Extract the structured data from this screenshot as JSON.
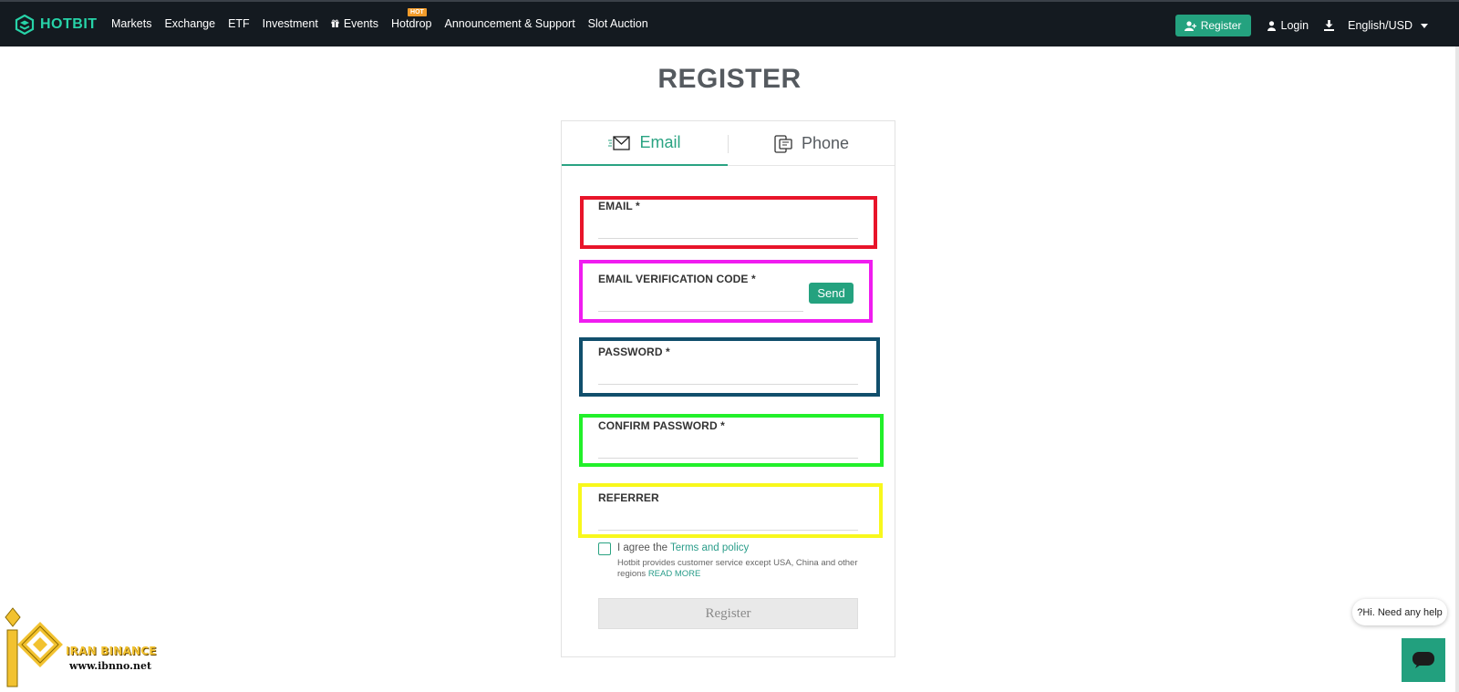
{
  "header": {
    "brand": "HOTBIT",
    "nav": [
      {
        "label": "Markets"
      },
      {
        "label": "Exchange"
      },
      {
        "label": "ETF"
      },
      {
        "label": "Investment"
      },
      {
        "label": "Events",
        "icon": "gift-icon"
      },
      {
        "label": "Hotdrop",
        "badge": "HOT"
      },
      {
        "label": "Announcement & Support"
      },
      {
        "label": "Slot Auction"
      }
    ],
    "register_label": "Register",
    "login_label": "Login",
    "language_label": "English/USD"
  },
  "page": {
    "title": "REGISTER"
  },
  "tabs": [
    {
      "label": "Email",
      "icon": "envelope-icon",
      "active": true
    },
    {
      "label": "Phone",
      "icon": "phone-icon",
      "active": false
    }
  ],
  "form": {
    "email_label": "EMAIL *",
    "email_value": "",
    "code_label": "EMAIL VERIFICATION CODE *",
    "code_value": "",
    "send_label": "Send",
    "password_label": "PASSWORD *",
    "password_value": "",
    "confirm_label": "CONFIRM PASSWORD *",
    "confirm_value": "",
    "referrer_label": "REFERRER",
    "referrer_value": "",
    "agree_prefix": "I agree the ",
    "terms_label": "Terms and policy",
    "note_text": "Hotbit provides customer service except USA, China and other regions ",
    "read_more_label": "READ MORE",
    "submit_label": "Register"
  },
  "highlight_colors": {
    "email": "#e8142a",
    "code": "#f01cf0",
    "password": "#114f6c",
    "confirm": "#22f02a",
    "referrer": "#f8f81c"
  },
  "chat": {
    "bubble_text": "?Hi. Need any help"
  },
  "watermark": {
    "line1": "IRAN BINANCE",
    "line2": "www.ibnno.net"
  },
  "colors": {
    "brand": "#27d3a8",
    "accent": "#24a27f",
    "topbar": "#141a20"
  }
}
